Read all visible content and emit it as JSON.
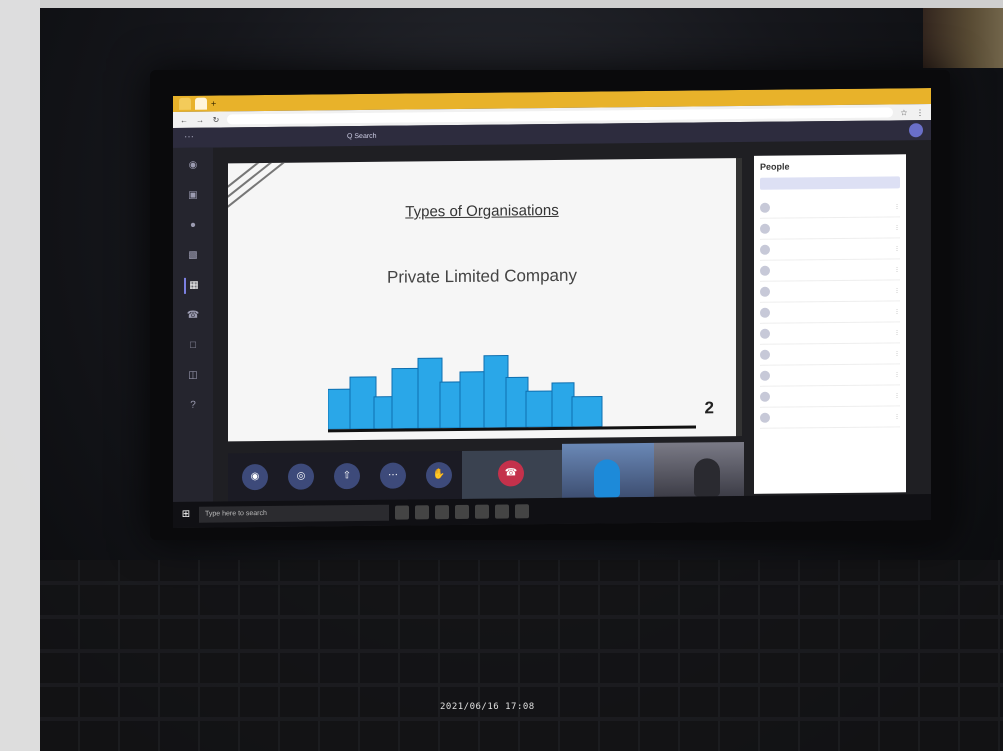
{
  "browser": {
    "tabs": [
      {
        "label": "",
        "active": false
      },
      {
        "label": "",
        "active": true
      }
    ],
    "new_tab_label": "+",
    "url": ""
  },
  "teams": {
    "title": "",
    "search_placeholder": "Q Search"
  },
  "slide": {
    "title": "Types of Organisations",
    "subtitle": "Private Limited Company",
    "page_number": "2"
  },
  "people_panel": {
    "title": "People",
    "invite_placeholder": "",
    "share_link": "",
    "section_label": "",
    "participants": [
      "",
      "",
      "",
      "",
      "",
      "",
      "",
      "",
      "",
      "",
      ""
    ]
  },
  "taskbar": {
    "search_placeholder": "Type here to search",
    "clock": ""
  },
  "photo_timestamp": "2021/06/16 17:08",
  "colors": {
    "teams_header": "#2d2c3e",
    "browser_tab_bar": "#e8b22a",
    "leave_button": "#c4314b",
    "skyline_blue": "#2aa7e8"
  }
}
